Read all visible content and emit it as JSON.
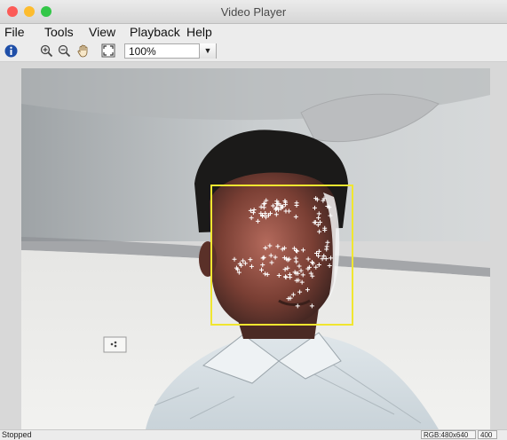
{
  "window": {
    "title": "Video Player"
  },
  "menubar": {
    "items": [
      "File",
      "Tools",
      "View",
      "Playback",
      "Help"
    ]
  },
  "toolbar": {
    "icons": [
      "info-icon",
      "zoom-in-icon",
      "zoom-out-icon",
      "pan-hand-icon",
      "fit-to-window-icon"
    ],
    "zoom_value": "100%"
  },
  "video": {
    "overlay_color": "#f0e630",
    "point_color": "#ffffff"
  },
  "status": {
    "text": "Stopped",
    "format": "RGB:480x640",
    "frame": "400"
  },
  "colors": {
    "close": "#fc5b57",
    "minimize": "#fdbc2e",
    "zoom": "#33c748"
  }
}
